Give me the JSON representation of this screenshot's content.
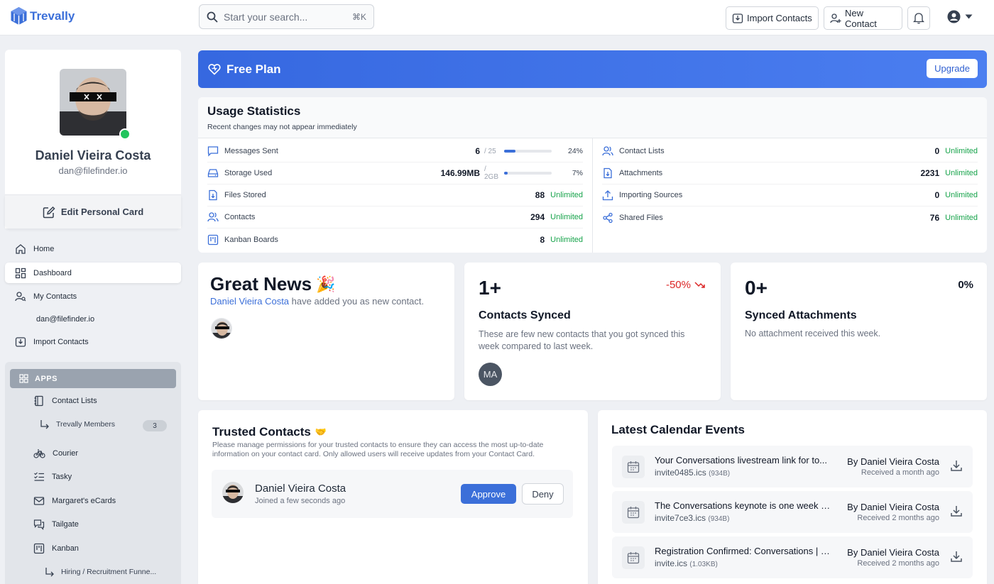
{
  "brand": {
    "name": "Trevally"
  },
  "search": {
    "placeholder": "Start your search...",
    "shortcut": "⌘K"
  },
  "header": {
    "import_label": "Import Contacts",
    "new_contact_label": "New Contact"
  },
  "profile": {
    "name": "Daniel Vieira Costa",
    "email": "dan@filefinder.io",
    "edit_label": "Edit Personal Card"
  },
  "nav": {
    "items": [
      {
        "label": "Home",
        "icon": "home-icon"
      },
      {
        "label": "Dashboard",
        "icon": "dashboard-icon"
      },
      {
        "label": "My Contacts",
        "icon": "user-search-icon"
      },
      {
        "label": "dan@filefinder.io"
      },
      {
        "label": "Import Contacts",
        "icon": "import-icon"
      }
    ]
  },
  "apps": {
    "header": "APPS",
    "items": [
      {
        "label": "Contact Lists",
        "icon": "notebook-icon"
      },
      {
        "label": "Trevally Members",
        "count": "3"
      },
      {
        "label": "Courier",
        "icon": "bicycle-icon"
      },
      {
        "label": "Tasky",
        "icon": "checklist-icon"
      },
      {
        "label": "Margaret's eCards",
        "icon": "mail-icon"
      },
      {
        "label": "Tailgate",
        "icon": "chat-icon"
      },
      {
        "label": "Kanban",
        "icon": "kanban-icon"
      },
      {
        "label": "Hiring / Recruitment Funne..."
      }
    ]
  },
  "plan": {
    "title": "Free Plan",
    "upgrade_label": "Upgrade"
  },
  "usage": {
    "title": "Usage Statistics",
    "subtitle": "Recent changes may not appear immediately",
    "left": [
      {
        "label": "Messages Sent",
        "value": "6",
        "limit": "/ 25",
        "percent": "24%",
        "fill": 24,
        "icon": "message-icon"
      },
      {
        "label": "Storage Used",
        "value": "146.99MB",
        "limit": "/ 2GB",
        "percent": "7%",
        "fill": 7,
        "icon": "storage-icon"
      },
      {
        "label": "Files Stored",
        "value": "88",
        "status": "Unlimited",
        "icon": "file-download-icon"
      },
      {
        "label": "Contacts",
        "value": "294",
        "status": "Unlimited",
        "icon": "users-icon"
      },
      {
        "label": "Kanban Boards",
        "value": "8",
        "status": "Unlimited",
        "icon": "kanban-icon"
      }
    ],
    "right": [
      {
        "label": "Contact Lists",
        "value": "0",
        "status": "Unlimited",
        "icon": "users-icon"
      },
      {
        "label": "Attachments",
        "value": "2231",
        "status": "Unlimited",
        "icon": "file-download-icon"
      },
      {
        "label": "Importing Sources",
        "value": "0",
        "status": "Unlimited",
        "icon": "upload-icon"
      },
      {
        "label": "Shared Files",
        "value": "76",
        "status": "Unlimited",
        "icon": "share-icon"
      }
    ]
  },
  "news": {
    "title": "Great News",
    "emoji": "🎉",
    "name_link": "Daniel Vieira Costa",
    "message": "have added you as new contact."
  },
  "synced": {
    "value": "1+",
    "change": "-50%",
    "title": "Contacts Synced",
    "desc": "These are few new contacts that you got synced this week compared to last week.",
    "initials": "MA"
  },
  "attachments": {
    "value": "0+",
    "change": "0%",
    "title": "Synced Attachments",
    "desc": "No attachment received this week."
  },
  "trusted": {
    "title": "Trusted Contacts",
    "emoji": "🤝",
    "desc": "Please manage permissions for your trusted contacts to ensure they can access the most up-to-date information on your contact card. Only allowed users will receive updates from your Contact Card.",
    "contact": {
      "name": "Daniel Vieira Costa",
      "joined": "Joined a few seconds ago"
    },
    "approve_label": "Approve",
    "deny_label": "Deny"
  },
  "calendar": {
    "title": "Latest Calendar Events",
    "events": [
      {
        "title": "Your Conversations livestream link for to...",
        "file": "invite0485.ics",
        "size": "(934B)",
        "by": "By Daniel Vieira Costa",
        "when": "Received a month ago"
      },
      {
        "title": "The Conversations keynote is one week a...",
        "file": "invite7ce3.ics",
        "size": "(934B)",
        "by": "By Daniel Vieira Costa",
        "when": "Received 2 months ago"
      },
      {
        "title": "Registration Confirmed: Conversations | J...",
        "file": "invite.ics",
        "size": "(1.03KB)",
        "by": "By Daniel Vieira Costa",
        "when": "Received 2 months ago"
      }
    ]
  },
  "colors": {
    "primary": "#3b6fd9",
    "success": "#16a34a",
    "danger": "#dc2626",
    "online": "#22c55e"
  }
}
